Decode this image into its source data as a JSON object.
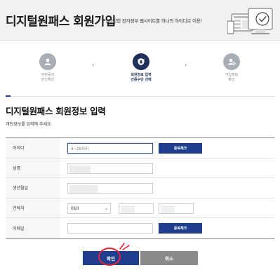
{
  "header": {
    "title": "디지털원패스 회원가입",
    "subtitle": "/ 다양한 전자정부 웹사이트를 하나의 아이디로 이용!"
  },
  "steps": [
    {
      "label": "약관동의\n본인확인",
      "icon": "user-icon",
      "active": false
    },
    {
      "label": "회원정보 입력\n인증수단 선택",
      "icon": "shield-icon",
      "active": true
    },
    {
      "label": "가입정보\n확인",
      "icon": "user-check-icon",
      "active": false
    }
  ],
  "section": {
    "title": "디지털원패스 회원정보 입력",
    "description": "개인정보를 입력해 주세요."
  },
  "form": {
    "id_label": "아이디",
    "id_placeholder": "4~16자리",
    "id_check_button": "중복체크",
    "name_label": "성명",
    "birth_label": "생년월일",
    "phone_label": "연락처",
    "phone_prefix": "010",
    "email_label": "이메일",
    "email_check_button": "중복체크"
  },
  "actions": {
    "confirm": "확인",
    "cancel": "취소"
  },
  "colors": {
    "primary": "#1f3f8e",
    "active_step": "#1d2f5a",
    "inactive_step": "#a9adb5",
    "annotation": "#e8203a"
  }
}
